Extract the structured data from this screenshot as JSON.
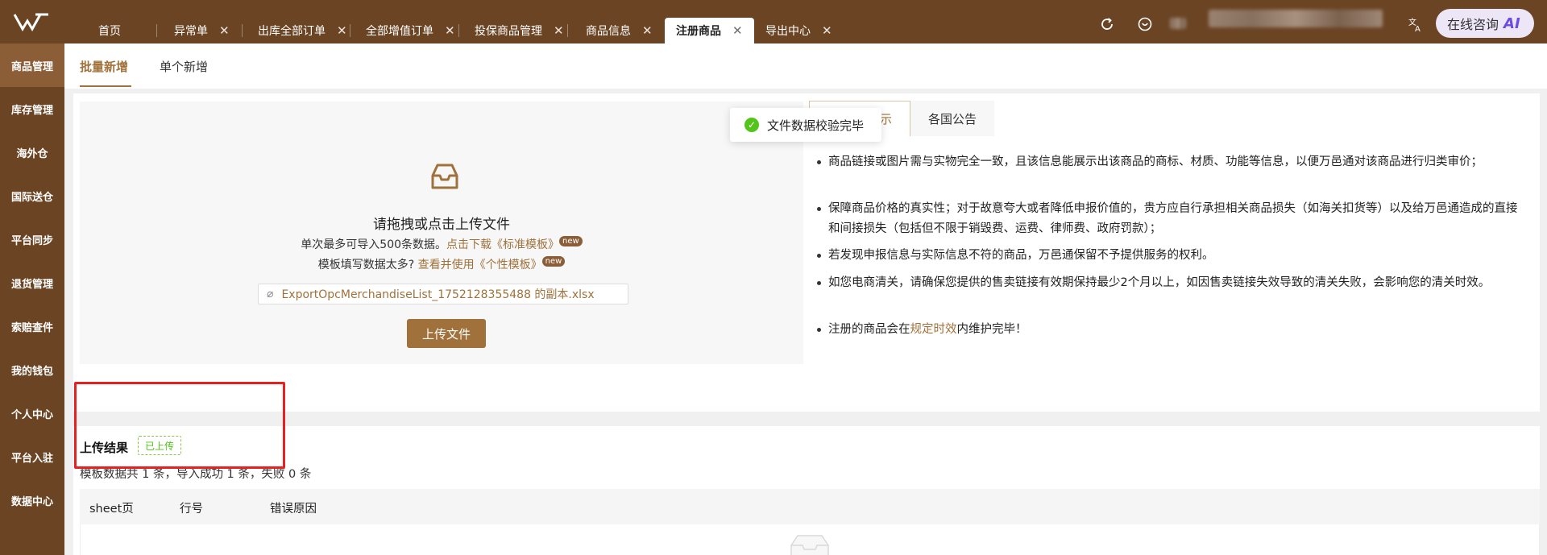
{
  "topbar": {
    "tabs": [
      {
        "label": "首页",
        "closable": false
      },
      {
        "label": "异常单",
        "closable": true
      },
      {
        "label": "出库全部订单",
        "closable": true
      },
      {
        "label": "全部增值订单",
        "closable": true
      },
      {
        "label": "投保商品管理",
        "closable": true
      },
      {
        "label": "商品信息",
        "closable": true
      },
      {
        "label": "注册商品",
        "closable": true,
        "active": true
      },
      {
        "label": "导出中心",
        "closable": true
      }
    ],
    "close_glyph": "✕",
    "ai_button": {
      "label": "在线咨询",
      "badge": "AI"
    },
    "icons": [
      "refresh-icon",
      "heart-icon",
      "translate-icon"
    ]
  },
  "sidebar": {
    "items": [
      {
        "label": "商品管理",
        "active": true
      },
      {
        "label": "库存管理"
      },
      {
        "label": "海外仓"
      },
      {
        "label": "国际送仓"
      },
      {
        "label": "平台同步"
      },
      {
        "label": "退货管理"
      },
      {
        "label": "索赔查件"
      },
      {
        "label": "我的钱包"
      },
      {
        "label": "个人中心"
      },
      {
        "label": "平台入驻"
      },
      {
        "label": "数据中心"
      }
    ]
  },
  "subtabs": {
    "batch": "批量新增",
    "single": "单个新增"
  },
  "upload": {
    "title": "请拖拽或点击上传文件",
    "line1_prefix": "单次最多可导入500条数据。",
    "line1_link": "点击下载《标准模板》",
    "line2_prefix": "模板填写数据太多?",
    "line2_link": "查看并使用《个性模板》",
    "new_tag": "new",
    "file_name": "ExportOpcMerchandiseList_1752128355488 的副本.xlsx",
    "button": "上传文件"
  },
  "toast": {
    "message": "文件数据校验完毕"
  },
  "notice": {
    "tab_active_visible": "示",
    "tab_other": "各国公告",
    "items": [
      {
        "text": "商品链接或图片需与实物完全一致，且该信息能展示出该商品的商标、材质、功能等信息，以便万邑通对该商品进行归类审价；"
      },
      {
        "text": "保障商品价格的真实性；对于故意夸大或者降低申报价值的，贵方应自行承担相关商品损失（如海关扣货等）以及给万邑通造成的直接和间接损失（包括但不限于销毁费、运费、律师费、政府罚款）；"
      },
      {
        "text": "若发现申报信息与实际信息不符的商品，万邑通保留不予提供服务的权利。"
      },
      {
        "text": "如您电商清关，请确保您提供的售卖链接有效期保持最少2个月以上，如因售卖链接失效导致的清关失败，会影响您的清关时效。"
      },
      {
        "prefix": "注册的商品会在",
        "link": "规定时效",
        "suffix": "内维护完毕！"
      }
    ]
  },
  "result": {
    "title": "上传结果",
    "badge": "已上传",
    "summary": "模板数据共 1 条，导入成功 1 条，失败 0 条",
    "columns": [
      "sheet页",
      "行号",
      "错误原因"
    ]
  }
}
